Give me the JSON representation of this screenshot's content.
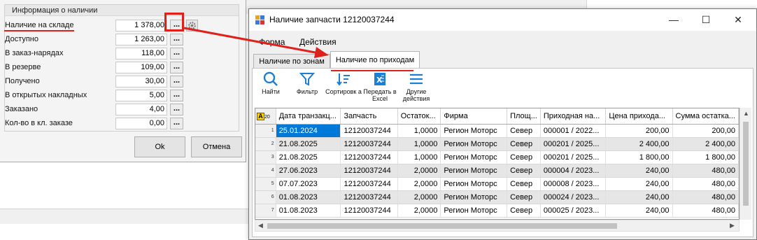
{
  "left_dialog": {
    "group_title": "Информация о наличии",
    "rows": [
      {
        "label": "Наличие на складе",
        "value": "1 378,00"
      },
      {
        "label": "Доступно",
        "value": "1 263,00"
      },
      {
        "label": "В заказ-нарядах",
        "value": "118,00"
      },
      {
        "label": "В резерве",
        "value": "109,00"
      },
      {
        "label": "Получено",
        "value": "30,00"
      },
      {
        "label": "В открытых накладных",
        "value": "5,00"
      },
      {
        "label": "Заказано",
        "value": "4,00"
      },
      {
        "label": "Кол-во в кл. заказе",
        "value": "0,00"
      }
    ],
    "dots_label": "...",
    "ok_label": "Ok",
    "cancel_label": "Отмена"
  },
  "window": {
    "title": "Наличие запчасти 12120037244",
    "min_glyph": "—",
    "max_glyph": "☐",
    "close_glyph": "✕",
    "menu": {
      "form": "Форма",
      "actions": "Действия"
    },
    "tabs": {
      "zones": "Наличие по зонам",
      "receipts": "Наличие по приходам"
    },
    "toolbar": {
      "find": "Найти",
      "filter": "Фильтр",
      "sort": "Сортировк а",
      "excel": "Передать в Excel",
      "other": "Другие действия"
    }
  },
  "grid": {
    "corner_letter": "A",
    "corner_count": "20",
    "columns": [
      "Дата транзакц...",
      "Запчасть",
      "Остаток...",
      "Фирма",
      "Площ...",
      "Приходная на...",
      "Цена прихода...",
      "Сумма остатка..."
    ],
    "rows": [
      {
        "n": "1",
        "date": "25.01.2024",
        "part": "12120037244",
        "qty": "1,0000",
        "firm": "Регион Моторс",
        "area": "Север",
        "doc": "000001 / 2022...",
        "price": "200,00",
        "sum": "200,00"
      },
      {
        "n": "2",
        "date": "21.08.2025",
        "part": "12120037244",
        "qty": "1,0000",
        "firm": "Регион Моторс",
        "area": "Север",
        "doc": "000201 / 2025...",
        "price": "2 400,00",
        "sum": "2 400,00"
      },
      {
        "n": "3",
        "date": "21.08.2025",
        "part": "12120037244",
        "qty": "1,0000",
        "firm": "Регион Моторс",
        "area": "Север",
        "doc": "000201 / 2025...",
        "price": "1 800,00",
        "sum": "1 800,00"
      },
      {
        "n": "4",
        "date": "27.06.2023",
        "part": "12120037244",
        "qty": "2,0000",
        "firm": "Регион Моторс",
        "area": "Север",
        "doc": "000004 / 2023...",
        "price": "240,00",
        "sum": "480,00"
      },
      {
        "n": "5",
        "date": "07.07.2023",
        "part": "12120037244",
        "qty": "2,0000",
        "firm": "Регион Моторс",
        "area": "Север",
        "doc": "000008 / 2023...",
        "price": "240,00",
        "sum": "480,00"
      },
      {
        "n": "6",
        "date": "01.08.2023",
        "part": "12120037244",
        "qty": "2,0000",
        "firm": "Регион Моторс",
        "area": "Север",
        "doc": "000024 / 2023...",
        "price": "240,00",
        "sum": "480,00"
      },
      {
        "n": "7",
        "date": "01.08.2023",
        "part": "12120037244",
        "qty": "2,0000",
        "firm": "Регион Моторс",
        "area": "Север",
        "doc": "000025 / 2023...",
        "price": "240,00",
        "sum": "480,00"
      }
    ]
  },
  "colors": {
    "annotation": "#e0201b",
    "selection": "#0078d7",
    "accent_icon": "#1c7fd6"
  }
}
